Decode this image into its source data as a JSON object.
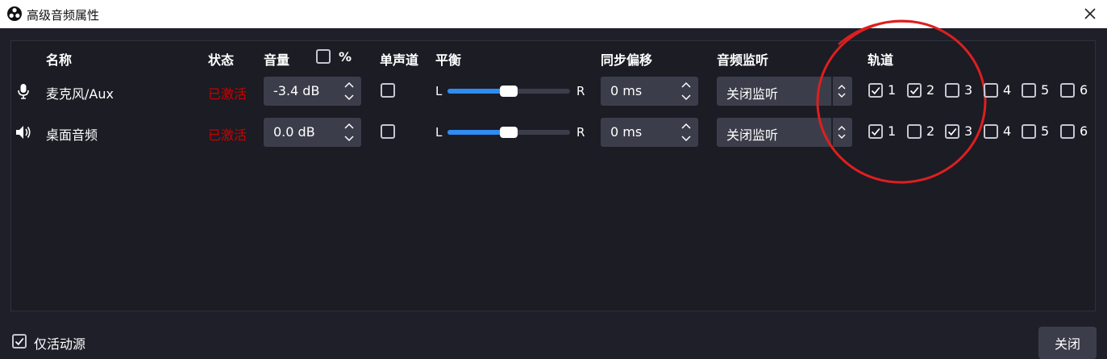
{
  "window": {
    "title": "高级音频属性",
    "close_icon": "close-icon"
  },
  "headers": {
    "name": "名称",
    "status": "状态",
    "volume": "音量",
    "percent": "%",
    "mono": "单声道",
    "balance": "平衡",
    "sync_offset": "同步偏移",
    "monitoring": "音频监听",
    "tracks": "轨道"
  },
  "percent_checked": false,
  "rows": [
    {
      "icon": "microphone-icon",
      "name": "麦克风/Aux",
      "status": "已激活",
      "volume": "-3.4 dB",
      "mono": false,
      "balance_left": "L",
      "balance_right": "R",
      "balance": 0.5,
      "sync": "0 ms",
      "monitoring": "关闭监听",
      "tracks": [
        {
          "label": "1",
          "checked": true
        },
        {
          "label": "2",
          "checked": true
        },
        {
          "label": "3",
          "checked": false
        },
        {
          "label": "4",
          "checked": false
        },
        {
          "label": "5",
          "checked": false
        },
        {
          "label": "6",
          "checked": false
        }
      ]
    },
    {
      "icon": "speaker-icon",
      "name": "桌面音频",
      "status": "已激活",
      "volume": "0.0 dB",
      "mono": false,
      "balance_left": "L",
      "balance_right": "R",
      "balance": 0.5,
      "sync": "0 ms",
      "monitoring": "关闭监听",
      "tracks": [
        {
          "label": "1",
          "checked": true
        },
        {
          "label": "2",
          "checked": false
        },
        {
          "label": "3",
          "checked": true
        },
        {
          "label": "4",
          "checked": false
        },
        {
          "label": "5",
          "checked": false
        },
        {
          "label": "6",
          "checked": false
        }
      ]
    }
  ],
  "footer": {
    "active_only_label": "仅活动源",
    "active_only_checked": true,
    "close_label": "关闭"
  },
  "colors": {
    "status_active": "#cc0000",
    "slider_accent": "#2f8cf2",
    "annotation": "#dd1f1f"
  }
}
